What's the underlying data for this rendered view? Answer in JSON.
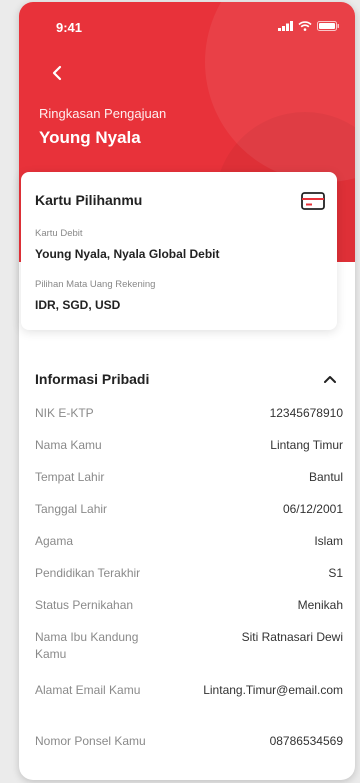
{
  "status": {
    "time": "9:41"
  },
  "header": {
    "subtitle": "Ringkasan Pengajuan",
    "title": "Young Nyala"
  },
  "card": {
    "title": "Kartu Pilihanmu",
    "debit_label": "Kartu Debit",
    "debit_value": "Young Nyala, Nyala Global Debit",
    "currency_label": "Pilihan Mata Uang Rekening",
    "currency_value": "IDR, SGD, USD"
  },
  "personal": {
    "title": "Informasi Pribadi",
    "rows": [
      {
        "label": "NIK E-KTP",
        "value": "12345678910"
      },
      {
        "label": "Nama Kamu",
        "value": "Lintang Timur"
      },
      {
        "label": "Tempat Lahir",
        "value": "Bantul"
      },
      {
        "label": "Tanggal Lahir",
        "value": "06/12/2001"
      },
      {
        "label": "Agama",
        "value": "Islam"
      },
      {
        "label": "Pendidikan Terakhir",
        "value": "S1"
      },
      {
        "label": "Status Pernikahan",
        "value": "Menikah"
      },
      {
        "label": "Nama Ibu Kandung Kamu",
        "value": "Siti Ratnasari Dewi"
      },
      {
        "label": "Alamat Email Kamu",
        "value": "Lintang.Timur@email.com"
      },
      {
        "label": "Nomor Ponsel Kamu",
        "value": "08786534569"
      }
    ]
  },
  "colors": {
    "brand": "#e8323a"
  }
}
